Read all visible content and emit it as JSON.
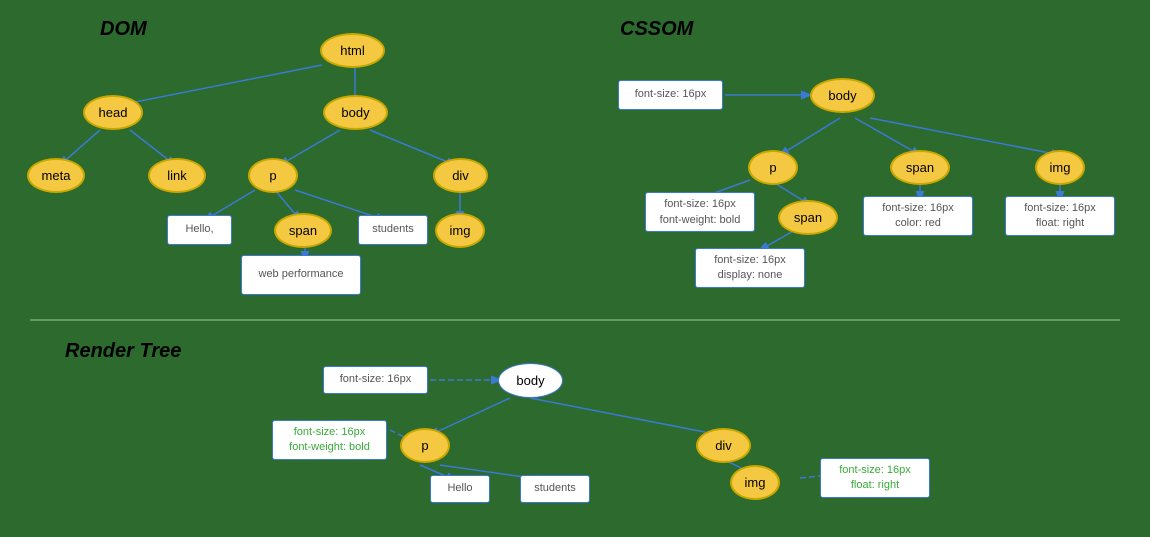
{
  "sections": {
    "dom": {
      "label": "DOM"
    },
    "cssom": {
      "label": "CSSOM"
    },
    "render_tree": {
      "label": "Render Tree"
    }
  },
  "dom_nodes": {
    "html": "html",
    "head": "head",
    "body": "body",
    "meta": "meta",
    "link": "link",
    "p": "p",
    "div": "div",
    "span": "span",
    "img": "img"
  },
  "dom_rects": {
    "hello": "Hello,",
    "students": "students",
    "web_performance": "web performance"
  },
  "cssom_nodes": {
    "body": "body",
    "p": "p",
    "span_p": "span",
    "span": "span",
    "img": "img"
  },
  "cssom_rects": {
    "body_style": "font-size: 16px",
    "p_style": "font-size: 16px\nfont-weight: bold",
    "span_p_style": "font-size: 16px\ndisplay: none",
    "span_style": "font-size: 16px\ncolor: red",
    "img_style": "font-size: 16px\nfloat: right"
  },
  "render_nodes": {
    "body": "body",
    "p": "p",
    "div": "div",
    "img": "img"
  },
  "render_rects": {
    "body_style": "font-size: 16px",
    "p_style": "font-size: 16px\nfont-weight: bold",
    "hello": "Hello",
    "students": "students",
    "img_style": "font-size: 16px\nfloat: right"
  }
}
